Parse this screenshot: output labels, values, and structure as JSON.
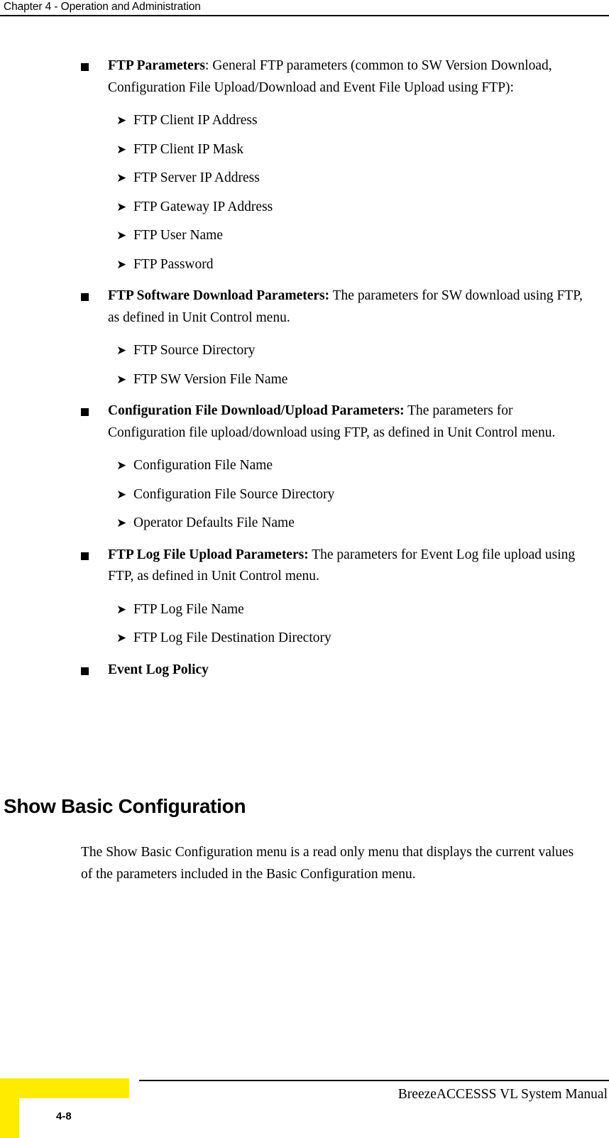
{
  "header": {
    "chapter_title": "Chapter 4 - Operation and Administration"
  },
  "content": {
    "bullets": [
      {
        "marker": "square-bullet",
        "lead": "FTP Parameters",
        "rest": ": General FTP parameters (common to SW Version Download, Configuration File Upload/Download and Event File Upload using FTP):",
        "subitems": [
          "FTP Client IP Address",
          "FTP Client IP Mask",
          "FTP Server IP Address",
          "FTP Gateway IP Address",
          "FTP User Name",
          "FTP Password"
        ]
      },
      {
        "marker": "square-bullet",
        "lead": "FTP Software Download Parameters:",
        "rest": " The parameters for SW download using FTP, as defined in Unit Control menu.",
        "subitems": [
          "FTP Source Directory",
          "FTP SW Version File Name"
        ]
      },
      {
        "marker": "square-bullet",
        "lead": "Configuration File Download/Upload Parameters:",
        "rest": " The parameters for Configuration file upload/download using FTP, as defined in Unit Control menu.",
        "subitems": [
          "Configuration File Name",
          "Configuration File Source Directory",
          "Operator Defaults File Name"
        ]
      },
      {
        "marker": "square-bullet",
        "lead": "FTP Log File Upload Parameters:",
        "rest": " The parameters for Event Log file upload using FTP, as defined in Unit Control menu.",
        "subitems": [
          "FTP Log File Name",
          "FTP Log File Destination Directory"
        ]
      },
      {
        "marker": "square-bullet",
        "lead": "Event Log Policy",
        "rest": "",
        "subitems": []
      }
    ],
    "section_heading": "Show Basic Configuration",
    "paragraph": "The Show Basic Configuration menu is a read only menu that displays the current values of the parameters included in the Basic Configuration menu."
  },
  "footer": {
    "manual_title": "BreezeACCESSS VL System Manual",
    "page_number": "4-8",
    "corner_mark_color": "#ffeb00"
  },
  "glyphs": {
    "sub_bullet_arrow": "➤"
  }
}
